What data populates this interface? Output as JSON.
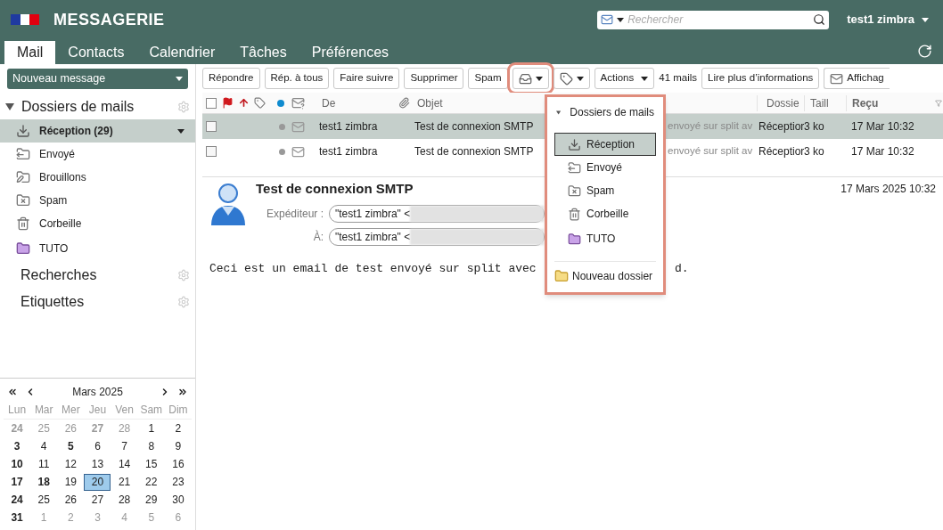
{
  "header": {
    "title": "MESSAGERIE",
    "search": {
      "placeholder": "Rechercher"
    },
    "user": "test1 zimbra"
  },
  "tabs": [
    {
      "label": "Mail",
      "selected": true
    },
    {
      "label": "Contacts",
      "selected": false
    },
    {
      "label": "Calendrier",
      "selected": false
    },
    {
      "label": "Tâches",
      "selected": false
    },
    {
      "label": "Préférences",
      "selected": false
    }
  ],
  "toolbar": {
    "new_message": "Nouveau message",
    "buttons": [
      {
        "kind": "text",
        "label": "Répondre"
      },
      {
        "kind": "text",
        "label": "Rép. à tous"
      },
      {
        "kind": "text",
        "label": "Faire suivre"
      },
      {
        "kind": "text",
        "label": "Supprimer"
      },
      {
        "kind": "text",
        "label": "Spam"
      },
      {
        "kind": "move",
        "highlighted": true
      },
      {
        "kind": "tag",
        "highlighted": false
      },
      {
        "kind": "menu",
        "label": "Actions"
      },
      {
        "kind": "count",
        "label": "41 mails"
      },
      {
        "kind": "text",
        "label": "Lire plus d’informations"
      },
      {
        "kind": "view",
        "label": "Affichag"
      }
    ]
  },
  "sidebar": {
    "header": {
      "label": "Dossiers de mails",
      "expanded": true
    },
    "folders": [
      {
        "kind": "inbox",
        "label": "Réception (29)",
        "selected": true
      },
      {
        "kind": "sent",
        "label": "Envoyé",
        "selected": false
      },
      {
        "kind": "drafts",
        "label": "Brouillons",
        "selected": false
      },
      {
        "kind": "spam",
        "label": "Spam",
        "selected": false
      },
      {
        "kind": "trash",
        "label": "Corbeille",
        "selected": false
      },
      {
        "kind": "folder",
        "label": "TUTO",
        "selected": false
      }
    ],
    "sections": [
      "Recherches",
      "Etiquettes"
    ]
  },
  "calendar": {
    "month": "Mars 2025",
    "weekdays": [
      "Lun",
      "Mar",
      "Mer",
      "Jeu",
      "Ven",
      "Sam",
      "Dim"
    ],
    "weeks": [
      [
        {
          "day": "24",
          "muted": true,
          "bold": true,
          "selected": false
        },
        {
          "day": "25",
          "muted": true,
          "bold": false,
          "selected": false
        },
        {
          "day": "26",
          "muted": true,
          "bold": false,
          "selected": false
        },
        {
          "day": "27",
          "muted": true,
          "bold": true,
          "selected": false
        },
        {
          "day": "28",
          "muted": true,
          "bold": false,
          "selected": false
        },
        {
          "day": "1",
          "muted": false,
          "bold": false,
          "selected": false
        },
        {
          "day": "2",
          "muted": false,
          "bold": false,
          "selected": false
        }
      ],
      [
        {
          "day": "3",
          "muted": false,
          "bold": true,
          "selected": false
        },
        {
          "day": "4",
          "muted": false,
          "bold": false,
          "selected": false
        },
        {
          "day": "5",
          "muted": false,
          "bold": true,
          "selected": false
        },
        {
          "day": "6",
          "muted": false,
          "bold": false,
          "selected": false
        },
        {
          "day": "7",
          "muted": false,
          "bold": false,
          "selected": false
        },
        {
          "day": "8",
          "muted": false,
          "bold": false,
          "selected": false
        },
        {
          "day": "9",
          "muted": false,
          "bold": false,
          "selected": false
        }
      ],
      [
        {
          "day": "10",
          "muted": false,
          "bold": true,
          "selected": false
        },
        {
          "day": "11",
          "muted": false,
          "bold": false,
          "selected": false
        },
        {
          "day": "12",
          "muted": false,
          "bold": false,
          "selected": false
        },
        {
          "day": "13",
          "muted": false,
          "bold": false,
          "selected": false
        },
        {
          "day": "14",
          "muted": false,
          "bold": false,
          "selected": false
        },
        {
          "day": "15",
          "muted": false,
          "bold": false,
          "selected": false
        },
        {
          "day": "16",
          "muted": false,
          "bold": false,
          "selected": false
        }
      ],
      [
        {
          "day": "17",
          "muted": false,
          "bold": true,
          "selected": false
        },
        {
          "day": "18",
          "muted": false,
          "bold": true,
          "selected": false
        },
        {
          "day": "19",
          "muted": false,
          "bold": false,
          "selected": false
        },
        {
          "day": "20",
          "muted": false,
          "bold": false,
          "selected": true
        },
        {
          "day": "21",
          "muted": false,
          "bold": false,
          "selected": false
        },
        {
          "day": "22",
          "muted": false,
          "bold": false,
          "selected": false
        },
        {
          "day": "23",
          "muted": false,
          "bold": false,
          "selected": false
        }
      ],
      [
        {
          "day": "24",
          "muted": false,
          "bold": true,
          "selected": false
        },
        {
          "day": "25",
          "muted": false,
          "bold": false,
          "selected": false
        },
        {
          "day": "26",
          "muted": false,
          "bold": false,
          "selected": false
        },
        {
          "day": "27",
          "muted": false,
          "bold": false,
          "selected": false
        },
        {
          "day": "28",
          "muted": false,
          "bold": false,
          "selected": false
        },
        {
          "day": "29",
          "muted": false,
          "bold": false,
          "selected": false
        },
        {
          "day": "30",
          "muted": false,
          "bold": false,
          "selected": false
        }
      ],
      [
        {
          "day": "31",
          "muted": false,
          "bold": true,
          "selected": false
        },
        {
          "day": "1",
          "muted": true,
          "bold": false,
          "selected": false
        },
        {
          "day": "2",
          "muted": true,
          "bold": false,
          "selected": false
        },
        {
          "day": "3",
          "muted": true,
          "bold": false,
          "selected": false
        },
        {
          "day": "4",
          "muted": true,
          "bold": false,
          "selected": false
        },
        {
          "day": "5",
          "muted": true,
          "bold": false,
          "selected": false
        },
        {
          "day": "6",
          "muted": true,
          "bold": false,
          "selected": false
        }
      ]
    ]
  },
  "message_list": {
    "all_checked": false,
    "columns": {
      "from": "De",
      "subject": "Objet",
      "folder": "Dossie",
      "size": "Taill",
      "received": "Reçu"
    },
    "rows": [
      {
        "selected": true,
        "checked": false,
        "from": "test1 zimbra",
        "subject": "Test de connexion SMTP",
        "fragment": "envoyé sur split av",
        "folder": "Réceptior",
        "size": "3 ko",
        "received": "17 Mar 10:32"
      },
      {
        "selected": false,
        "checked": false,
        "from": "test1 zimbra",
        "subject": "Test de connexion SMTP",
        "fragment": "envoyé sur split av",
        "folder": "Réceptior",
        "size": "3 ko",
        "received": "17 Mar 10:32"
      }
    ]
  },
  "reading": {
    "subject": "Test de connexion SMTP",
    "date": "17 Mars 2025 10:32",
    "from_label": "Expéditeur :",
    "from_value": "\"test1 zimbra\" <",
    "to_label": "À:",
    "to_value": "\"test1 zimbra\" <",
    "body_start": "Ceci est un email de test envoyé sur split avec",
    "body_end": "d."
  },
  "move_menu": {
    "header": "Dossiers de mails",
    "items": [
      {
        "kind": "inbox",
        "label": "Réception",
        "selected": true
      },
      {
        "kind": "sent",
        "label": "Envoyé",
        "selected": false
      },
      {
        "kind": "spam",
        "label": "Spam",
        "selected": false
      },
      {
        "kind": "trash",
        "label": "Corbeille",
        "selected": false
      },
      {
        "kind": "folder",
        "label": "TUTO",
        "selected": false
      }
    ],
    "footer": "Nouveau dossier"
  }
}
